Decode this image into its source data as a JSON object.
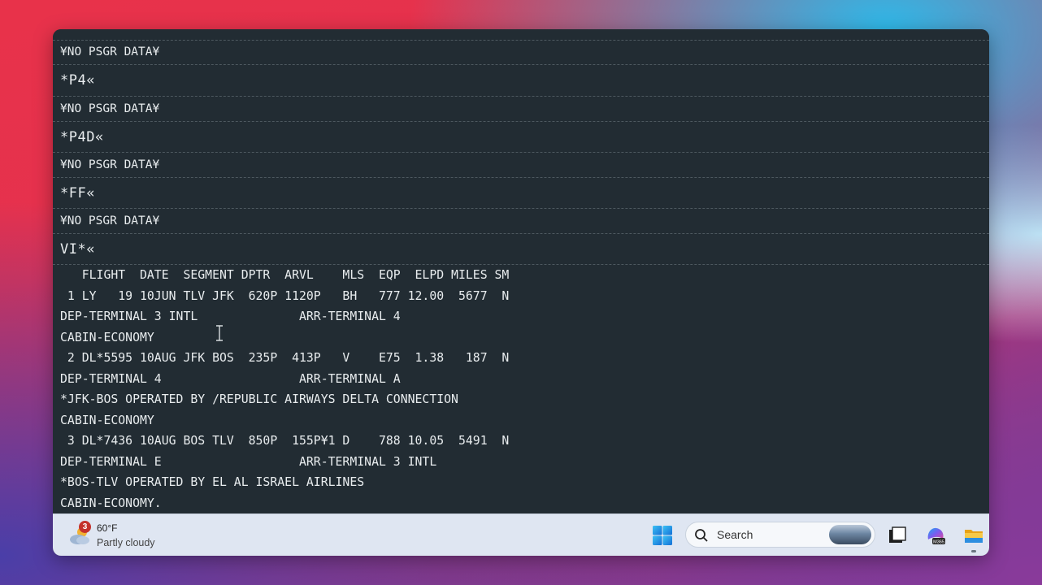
{
  "terminal": {
    "blocks": [
      {
        "type": "resp",
        "text": "¥NO PSGR DATA¥"
      },
      {
        "type": "cmd",
        "text": "*P4«"
      },
      {
        "type": "resp",
        "text": "¥NO PSGR DATA¥"
      },
      {
        "type": "cmd",
        "text": "*P4D«"
      },
      {
        "type": "resp",
        "text": "¥NO PSGR DATA¥"
      },
      {
        "type": "cmd",
        "text": "*FF«"
      },
      {
        "type": "resp",
        "text": "¥NO PSGR DATA¥"
      },
      {
        "type": "cmd",
        "text": "VI*«"
      }
    ],
    "output_lines": [
      "   FLIGHT  DATE  SEGMENT DPTR  ARVL    MLS  EQP  ELPD MILES SM",
      " 1 LY   19 10JUN TLV JFK  620P 1120P   BH   777 12.00  5677  N",
      "DEP-TERMINAL 3 INTL              ARR-TERMINAL 4",
      "CABIN-ECONOMY",
      " 2 DL*5595 10AUG JFK BOS  235P  413P   V    E75  1.38   187  N",
      "DEP-TERMINAL 4                   ARR-TERMINAL A",
      "*JFK-BOS OPERATED BY /REPUBLIC AIRWAYS DELTA CONNECTION",
      "CABIN-ECONOMY",
      " 3 DL*7436 10AUG BOS TLV  850P  155P¥1 D    788 10.05  5491  N",
      "DEP-TERMINAL E                   ARR-TERMINAL 3 INTL",
      "*BOS-TLV OPERATED BY EL AL ISRAEL AIRLINES",
      "CABIN-ECONOMY."
    ]
  },
  "taskbar": {
    "weather": {
      "badge_count": "3",
      "temperature": "60°F",
      "condition": "Partly cloudy",
      "icon": "partly-cloudy-icon"
    },
    "search": {
      "placeholder": "Search"
    },
    "icons": [
      "windows-start-icon",
      "search-icon",
      "task-view-icon",
      "copilot-m365-icon",
      "file-explorer-icon"
    ]
  },
  "colors": {
    "terminal_bg": "#222c33",
    "terminal_fg": "#e8ecee",
    "divider": "#4d585f",
    "taskbar_bg": "#dfe6f2"
  }
}
